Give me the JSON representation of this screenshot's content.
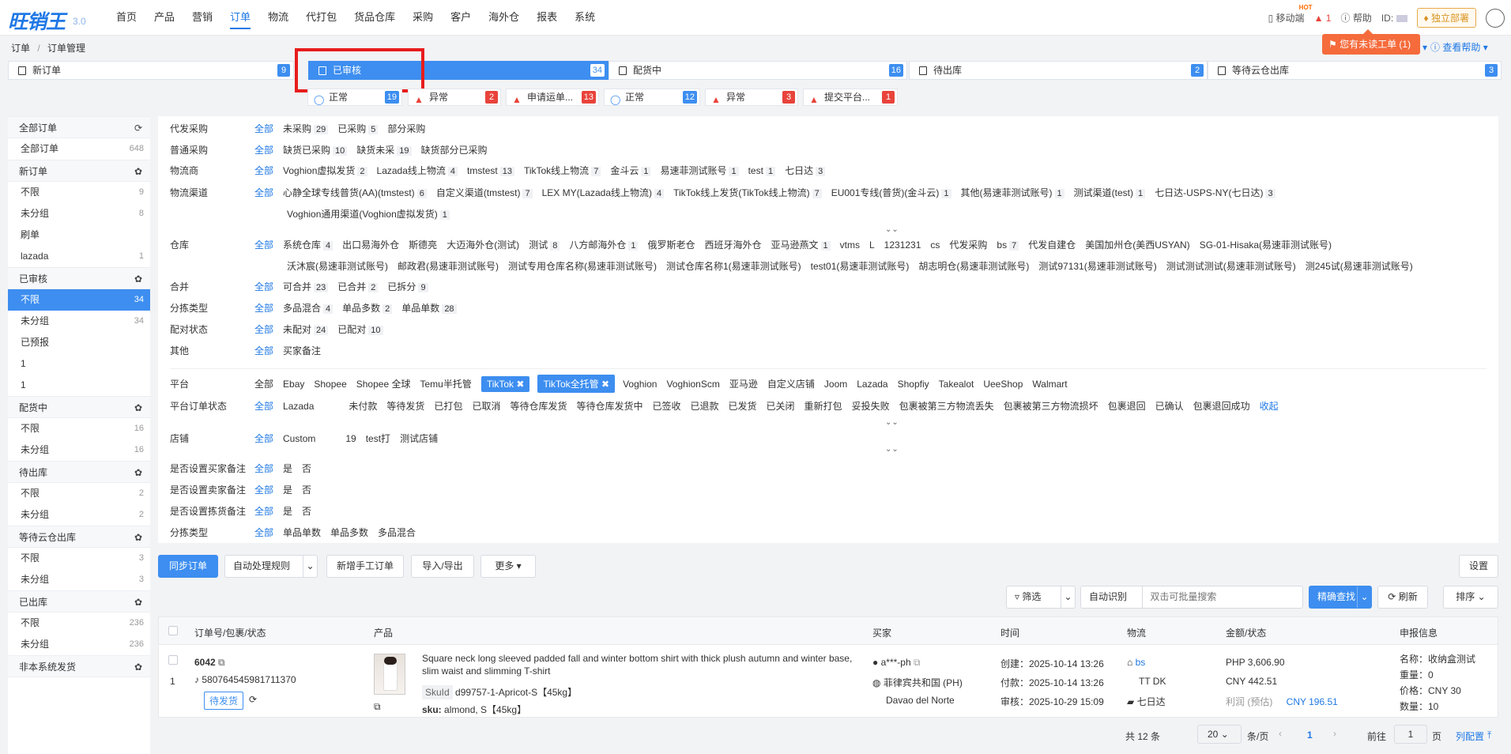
{
  "app": {
    "logo": "旺销王",
    "version": "3.0"
  },
  "nav": [
    "首页",
    "产品",
    "营销",
    "订单",
    "物流",
    "代打包",
    "货品仓库",
    "采购",
    "客户",
    "海外仓",
    "报表",
    "系统"
  ],
  "nav_active": 3,
  "topright": {
    "mobile": "移动端",
    "hot": "HOT",
    "alert_count": "1",
    "help": "帮助",
    "id_label": "ID:",
    "deploy": "独立部署"
  },
  "breadcrumb": {
    "root": "订单",
    "sep": "/",
    "current": "订单管理"
  },
  "toast": "您有未读工单 (1)",
  "help_link": "查看帮助",
  "steps": [
    {
      "label": "新订单",
      "count": "9"
    },
    {
      "label": "已审核",
      "count": "34"
    },
    {
      "label": "配货中",
      "count": "16"
    },
    {
      "label": "待出库",
      "count": "2"
    },
    {
      "label": "等待云仓出库",
      "count": "3"
    }
  ],
  "substeps": [
    {
      "label": "正常",
      "count": "19",
      "kind": "ok"
    },
    {
      "label": "异常",
      "count": "2",
      "kind": "warn"
    },
    {
      "label": "申请运单...",
      "count": "13",
      "kind": "warn"
    },
    {
      "label": "正常",
      "count": "12",
      "kind": "ok"
    },
    {
      "label": "异常",
      "count": "3",
      "kind": "warn"
    },
    {
      "label": "提交平台...",
      "count": "1",
      "kind": "warn"
    }
  ],
  "sidebar": [
    {
      "type": "head",
      "label": "全部订单",
      "icon": "refresh-icon"
    },
    {
      "type": "item",
      "label": "全部订单",
      "count": "648"
    },
    {
      "type": "head",
      "label": "新订单",
      "icon": "gear-icon"
    },
    {
      "type": "item",
      "label": "不限",
      "count": "9"
    },
    {
      "type": "item",
      "label": "未分组",
      "count": "8"
    },
    {
      "type": "item",
      "label": "刷单",
      "count": ""
    },
    {
      "type": "item",
      "label": "lazada",
      "count": "1"
    },
    {
      "type": "head",
      "label": "已审核",
      "icon": "gear-icon"
    },
    {
      "type": "item",
      "label": "不限",
      "count": "34",
      "selected": true
    },
    {
      "type": "item",
      "label": "未分组",
      "count": "34"
    },
    {
      "type": "item",
      "label": "已预报",
      "count": ""
    },
    {
      "type": "item",
      "label": "1",
      "count": ""
    },
    {
      "type": "item",
      "label": "1",
      "count": ""
    },
    {
      "type": "head",
      "label": "配货中",
      "icon": "gear-icon"
    },
    {
      "type": "item",
      "label": "不限",
      "count": "16"
    },
    {
      "type": "item",
      "label": "未分组",
      "count": "16"
    },
    {
      "type": "head",
      "label": "待出库",
      "icon": "gear-icon"
    },
    {
      "type": "item",
      "label": "不限",
      "count": "2"
    },
    {
      "type": "item",
      "label": "未分组",
      "count": "2"
    },
    {
      "type": "head",
      "label": "等待云仓出库",
      "icon": "gear-icon"
    },
    {
      "type": "item",
      "label": "不限",
      "count": "3"
    },
    {
      "type": "item",
      "label": "未分组",
      "count": "3"
    },
    {
      "type": "head",
      "label": "已出库",
      "icon": "gear-icon"
    },
    {
      "type": "item",
      "label": "不限",
      "count": "236"
    },
    {
      "type": "item",
      "label": "未分组",
      "count": "236"
    },
    {
      "type": "head",
      "label": "非本系统发货",
      "icon": "gear-icon"
    }
  ],
  "filter_all": "全部",
  "filters": [
    {
      "label": "代发采购",
      "opts": [
        [
          "未采购",
          "29"
        ],
        [
          "已采购",
          "5"
        ],
        [
          "部分采购",
          ""
        ]
      ]
    },
    {
      "label": "普通采购",
      "opts": [
        [
          "缺货已采购",
          "10"
        ],
        [
          "缺货未采",
          "19"
        ],
        [
          "缺货部分已采购",
          ""
        ]
      ]
    },
    {
      "label": "物流商",
      "opts": [
        [
          "Voghion虚拟发货",
          "2"
        ],
        [
          "Lazada线上物流",
          "4"
        ],
        [
          "tmstest",
          "13"
        ],
        [
          "TikTok线上物流",
          "7"
        ],
        [
          "金斗云",
          "1"
        ],
        [
          "易速菲测试账号",
          "1"
        ],
        [
          "test",
          "1"
        ],
        [
          "七日达",
          "3"
        ]
      ]
    },
    {
      "label": "物流渠道",
      "opts": [
        [
          "心静全球专线普货(AA)(tmstest)",
          "6"
        ],
        [
          "自定义渠道(tmstest)",
          "7"
        ],
        [
          "LEX MY(Lazada线上物流)",
          "4"
        ],
        [
          "TikTok线上发货(TikTok线上物流)",
          "7"
        ],
        [
          "EU001专线(普货)(金斗云)",
          "1"
        ],
        [
          "其他(易速菲测试账号)",
          "1"
        ],
        [
          "测试渠道(test)",
          "1"
        ],
        [
          "七日达-USPS-NY(七日达)",
          "3"
        ]
      ]
    },
    {
      "label": "",
      "opts": [
        [
          "Voghion通用渠道(Voghion虚拟发货)",
          "1"
        ]
      ]
    },
    {
      "label": "仓库",
      "opts": [
        [
          "系统仓库",
          "4"
        ],
        [
          "出口易海外仓",
          ""
        ],
        [
          "斯德亮",
          ""
        ],
        [
          "大迈海外仓(测试)",
          ""
        ],
        [
          "测试",
          "8"
        ],
        [
          "八方邮海外仓",
          "1"
        ],
        [
          "俄罗斯老仓",
          ""
        ],
        [
          "西班牙海外仓",
          ""
        ],
        [
          "亚马逊燕文",
          "1"
        ],
        [
          "vtms",
          ""
        ],
        [
          "L",
          ""
        ],
        [
          "1231231",
          ""
        ],
        [
          "cs",
          ""
        ],
        [
          "代发采购",
          ""
        ],
        [
          "bs",
          "7"
        ],
        [
          "代发自建仓",
          ""
        ],
        [
          "美国加州仓(美西USYAN)",
          ""
        ],
        [
          "SG-01-Hisaka(易速菲测试账号)",
          ""
        ]
      ]
    },
    {
      "label": "",
      "opts": [
        [
          "沃沐宸(易速菲测试账号)",
          ""
        ],
        [
          "邮政君(易速菲测试账号)",
          ""
        ],
        [
          "测试专用仓库名称(易速菲测试账号)",
          ""
        ],
        [
          "测试仓库名称1(易速菲测试账号)",
          ""
        ],
        [
          "test01(易速菲测试账号)",
          ""
        ],
        [
          "胡志明仓(易速菲测试账号)",
          ""
        ],
        [
          "测试97131(易速菲测试账号)",
          ""
        ],
        [
          "测试测试测试(易速菲测试账号)",
          ""
        ],
        [
          "测245试(易速菲测试账号)",
          ""
        ]
      ]
    },
    {
      "label": "合并",
      "opts": [
        [
          "可合并",
          "23"
        ],
        [
          "已合并",
          "2"
        ],
        [
          "已拆分",
          "9"
        ]
      ]
    },
    {
      "label": "分拣类型",
      "opts": [
        [
          "多品混合",
          "4"
        ],
        [
          "单品多数",
          "2"
        ],
        [
          "单品单数",
          "28"
        ]
      ]
    },
    {
      "label": "配对状态",
      "opts": [
        [
          "未配对",
          "24"
        ],
        [
          "已配对",
          "10"
        ]
      ]
    },
    {
      "label": "其他",
      "opts": [
        [
          "买家备注",
          ""
        ]
      ]
    }
  ],
  "platform": {
    "label": "平台",
    "all": "全部",
    "opts": [
      "Ebay",
      "Shopee",
      "Shopee 全球",
      "Temu半托管"
    ],
    "tags": [
      "TikTok",
      "TikTok全托管"
    ],
    "opts2": [
      "Voghion",
      "VoghionScm",
      "亚马逊",
      "自定义店铺",
      "Joom",
      "Lazada",
      "Shopfiy",
      "Takealot",
      "UeeShop",
      "Walmart"
    ]
  },
  "platform_status": {
    "label": "平台订单状态",
    "all": "全部",
    "platform": "Lazada",
    "opts": [
      "未付款",
      "等待发货",
      "已打包",
      "已取消",
      "等待仓库发货",
      "等待仓库发货中",
      "已签收",
      "已退款",
      "已发货",
      "已关闭",
      "重新打包",
      "妥投失败",
      "包裹被第三方物流丢失",
      "包裹被第三方物流损坏",
      "包裹退回",
      "已确认",
      "包裹退回成功"
    ],
    "collapse": "收起"
  },
  "shop": {
    "label": "店铺",
    "all": "全部",
    "opts": [
      "Custom",
      "19",
      "test打",
      "测试店铺"
    ]
  },
  "yesno": [
    {
      "label": "是否设置买家备注",
      "all": "全部",
      "yes": "是",
      "no": "否"
    },
    {
      "label": "是否设置卖家备注",
      "all": "全部",
      "yes": "是",
      "no": "否"
    },
    {
      "label": "是否设置拣货备注",
      "all": "全部",
      "yes": "是",
      "no": "否"
    }
  ],
  "sort_type": {
    "label": "分拣类型",
    "all": "全部",
    "opts": [
      "单品单数",
      "单品多数",
      "多品混合"
    ]
  },
  "toolbar": {
    "sync": "同步订单",
    "auto": "自动处理规则",
    "add": "新增手工订单",
    "import": "导入/导出",
    "more": "更多",
    "settings": "设置"
  },
  "search": {
    "filter": "筛选",
    "auto_identify": "自动识别",
    "placeholder": "双击可批量搜索",
    "precise": "精确查找",
    "refresh": "刷新",
    "sort": "排序"
  },
  "table_headers": [
    "订单号/包裹/状态",
    "产品",
    "买家",
    "时间",
    "物流",
    "金额/状态",
    "申报信息"
  ],
  "order": {
    "id": "6042",
    "index": "1",
    "tiktok_no": "580764545981711370",
    "status": "待发货",
    "product_title": "Square neck long sleeved padded fall and winter bottom shirt with thick plush autumn and winter base, slim waist and slimming T-shirt",
    "sku_tag": "SkuId",
    "sku_id": "d99757-1-Apricot-S【45kg】",
    "sku_label": "sku:",
    "sku": "almond, S【45kg】",
    "buyer": "a***-ph",
    "country": "菲律宾共和国 (PH)",
    "city": "Davao del Norte",
    "created": "创建：2025-10-14 13:26",
    "paid": "付款：2025-10-14 13:26",
    "audited": "审核：2025-10-29 15:09",
    "logistics": "bs",
    "logistics2": "TT DK",
    "logistics3": "七日达",
    "amount1": "PHP 3,606.90",
    "amount2": "CNY 442.51",
    "profit_label": "利润 (预估)",
    "profit": "CNY 196.51",
    "decl_name": "名称：收纳盒测试",
    "decl_weight": "重量：0",
    "decl_price": "价格：CNY 30",
    "decl_qty": "数量：10"
  },
  "pager": {
    "total": "共 12 条",
    "size": "20",
    "unit": "条/页",
    "page": "1",
    "goto": "前往",
    "page_input": "1",
    "page_unit": "页",
    "config": "列配置"
  }
}
